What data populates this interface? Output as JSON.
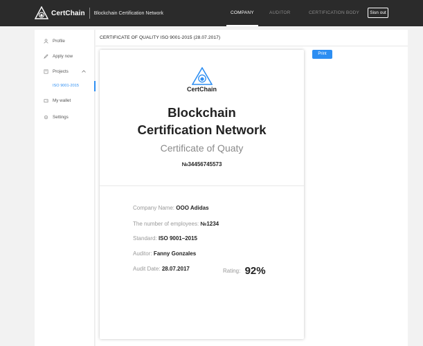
{
  "header": {
    "brand_name": "CertChain",
    "tagline": "Blockchain Certification Network",
    "nav": [
      {
        "label": "COMPANY",
        "active": true
      },
      {
        "label": "AUDITOR",
        "active": false
      },
      {
        "label": "CERTIFICATION BODY",
        "active": false
      }
    ],
    "signout_label": "Sisn out"
  },
  "sidebar": {
    "items": [
      {
        "label": "Profile",
        "icon": "user-icon"
      },
      {
        "label": "Apply now",
        "icon": "pencil-icon"
      },
      {
        "label": "Projects",
        "icon": "folder-icon"
      },
      {
        "label": "My wallet",
        "icon": "wallet-icon"
      },
      {
        "label": "Settings",
        "icon": "gear-icon"
      }
    ],
    "sub_item": "ISO 9001-2015"
  },
  "main": {
    "title": "CERTIFICATE OF QUALITY ISO 9001-2015 (28.07.2017)",
    "print_label": "Print"
  },
  "certificate": {
    "brand": "CertChain",
    "heading_line1": "Blockchain",
    "heading_line2": "Certification Network",
    "subheading": "Certificate of Quaty",
    "number": "№34456745573",
    "company_label": "Company Name:",
    "company_value": "OOO Adidas",
    "employees_label": "The number of employees:",
    "employees_value": "№1234",
    "standard_label": "Standard:",
    "standard_value": "ISO 9001–2015",
    "auditor_label": "Auditor:",
    "auditor_value": "Fanny Gonzales",
    "audit_date_label": "Audit Date:",
    "audit_date_value": "28.07.2017",
    "rating_label": "Rating:",
    "rating_value": "92%"
  },
  "colors": {
    "accent": "#2d8ef2",
    "topbar": "#2b2b2b"
  }
}
